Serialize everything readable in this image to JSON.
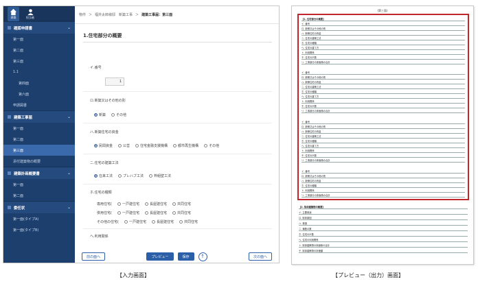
{
  "sidebar": {
    "icons": [
      {
        "label": "建築",
        "icon": "home-icon"
      },
      {
        "label": "担当者",
        "icon": "user-icon"
      }
    ],
    "sections": [
      {
        "label": "確認申請書",
        "items": [
          "第一面",
          "第二面",
          "第三面",
          "1.1",
          "第四面",
          "第六面",
          "申請図書"
        ],
        "sub": [
          false,
          false,
          false,
          false,
          true,
          true,
          false
        ]
      },
      {
        "label": "建築工事届",
        "items": [
          "第一面",
          "第二面",
          "第三面",
          "添付建築物の概要"
        ],
        "selected": 2
      },
      {
        "label": "建築計画概要書",
        "items": [
          "第一面",
          "第二面"
        ]
      },
      {
        "label": "委任状",
        "items": [
          "第一面(タイプA)",
          "第一面(タイプB)"
        ]
      }
    ]
  },
  "breadcrumb": [
    "物件",
    "福井太郎様邸　新築工事",
    "建築工事届：第三面"
  ],
  "page_title": "1.住宅部分の概要",
  "form": {
    "q1": "イ.番号",
    "q1_value": "1",
    "q2": "ロ.新築又はその他の別",
    "q2_options": [
      "新築",
      "その他"
    ],
    "q3": "ハ.新築住宅の資金",
    "q3_options": [
      "民間資金",
      "公営",
      "住宅金融支援機構",
      "都市再生機構",
      "その他"
    ],
    "q4": "ニ.住宅の建築工法",
    "q4_options": [
      "在来工法",
      "プレハブ工法",
      "枠組壁工法"
    ],
    "q5": "ホ.住宅の種類",
    "q5_rows": [
      {
        "label": "専用住宅(",
        "options": [
          "一戸建住宅",
          "長屋建住宅",
          "共同住宅"
        ]
      },
      {
        "label": "併用住宅(",
        "options": [
          "一戸建住宅",
          "長屋建住宅",
          "共同住宅"
        ]
      },
      {
        "label": "その他の住宅(",
        "options": [
          "一戸建住宅",
          "長屋建住宅",
          "共同住宅"
        ]
      }
    ],
    "q6": "ヘ.利用関係"
  },
  "buttons": {
    "prev": "前の面へ",
    "preview": "プレビュー",
    "save": "保存",
    "next": "次の面へ"
  },
  "peek_row": "前.同居",
  "preview_doc": {
    "sheet_no": "(第三面)",
    "section1_title": "【1. 住宅部分の概要】",
    "block_labels": [
      "イ. 番号",
      "ロ. 新築又はその他の別",
      "ハ. 新築住宅の資金",
      "ニ. 住宅の建築工法",
      "ホ. 住宅の種類",
      "ヘ. 住宅の建て方",
      "ト. 利用関係",
      "チ. 住宅の戸数",
      "リ. 工事部分の床面積の合計"
    ],
    "section2_title": "【2. 除却建築物の概要】",
    "section2_rows": [
      "イ. 主要用途",
      "ロ. 除却原因",
      "ハ. 構造",
      "ニ. 棟数の数",
      "ホ. 住宅の戸数",
      "ヘ. 住宅の利用関係",
      "ト. 除却建築物の床面積の合計",
      "チ. 除却建築物の評価額"
    ]
  },
  "captions": {
    "left": "【入力画面】",
    "right": "【プレビュー（出力）画面】"
  },
  "colors": {
    "sidebar": "#1d3f6e",
    "accent": "#2b5fa8",
    "highlight_frame": "#c0272d"
  }
}
